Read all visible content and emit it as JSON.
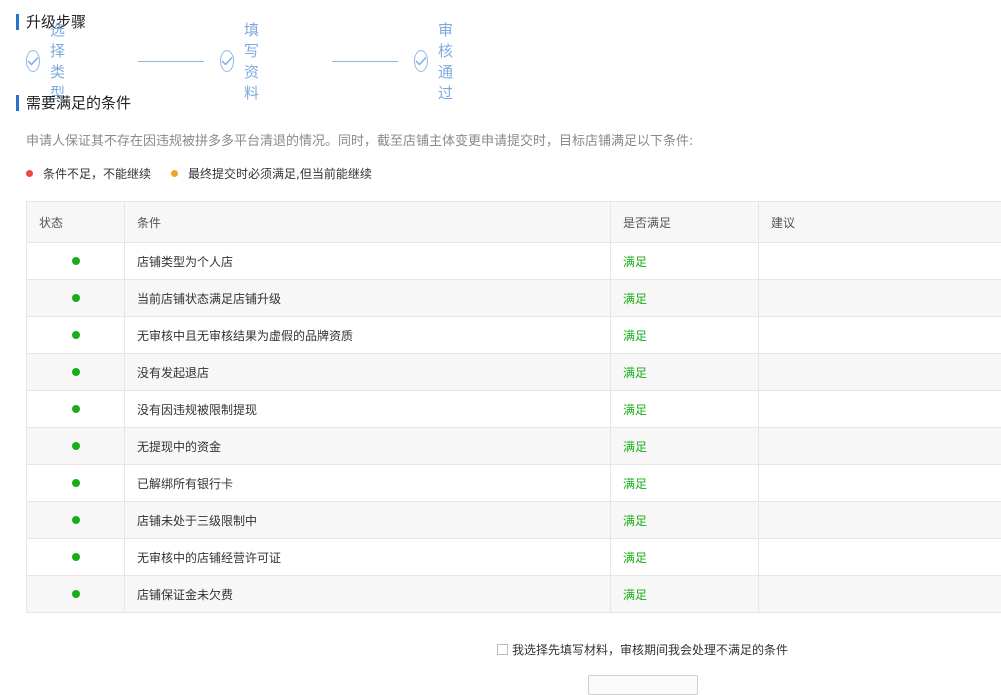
{
  "upgrade_steps": {
    "title": "升级步骤",
    "steps": [
      {
        "label": "选择类型",
        "icon": "check-icon"
      },
      {
        "label": "填写资料",
        "icon": "check-icon"
      },
      {
        "label": "审核通过",
        "icon": "check-icon"
      }
    ]
  },
  "conditions": {
    "title": "需要满足的条件",
    "description": "申请人保证其不存在因违规被拼多多平台清退的情况。同时，截至店铺主体变更申请提交时，目标店铺满足以下条件:",
    "legend": [
      {
        "label": "条件不足，不能继续",
        "color": "#e8474f"
      },
      {
        "label": "最终提交时必须满足,但当前能继续",
        "color": "#f0a42b"
      }
    ],
    "table": {
      "headers": [
        "状态",
        "条件",
        "是否满足",
        "建议"
      ],
      "rows": [
        {
          "condition": "店铺类型为个人店",
          "satisfied": "满足",
          "advice": ""
        },
        {
          "condition": "当前店铺状态满足店铺升级",
          "satisfied": "满足",
          "advice": ""
        },
        {
          "condition": "无审核中且无审核结果为虚假的品牌资质",
          "satisfied": "满足",
          "advice": ""
        },
        {
          "condition": "没有发起退店",
          "satisfied": "满足",
          "advice": ""
        },
        {
          "condition": "没有因违规被限制提现",
          "satisfied": "满足",
          "advice": ""
        },
        {
          "condition": "无提现中的资金",
          "satisfied": "满足",
          "advice": ""
        },
        {
          "condition": "已解绑所有银行卡",
          "satisfied": "满足",
          "advice": ""
        },
        {
          "condition": "店铺未处于三级限制中",
          "satisfied": "满足",
          "advice": ""
        },
        {
          "condition": "无审核中的店铺经营许可证",
          "satisfied": "满足",
          "advice": ""
        },
        {
          "condition": "店铺保证金未欠费",
          "satisfied": "满足",
          "advice": ""
        }
      ]
    },
    "status_color": "#1aad19"
  },
  "agreement": {
    "label": "我选择先填写材料，审核期间我会处理不满足的条件",
    "checked": false
  },
  "colors": {
    "accent": "#2b6fd1",
    "step": "#7fa9de",
    "ok": "#1aad19"
  }
}
